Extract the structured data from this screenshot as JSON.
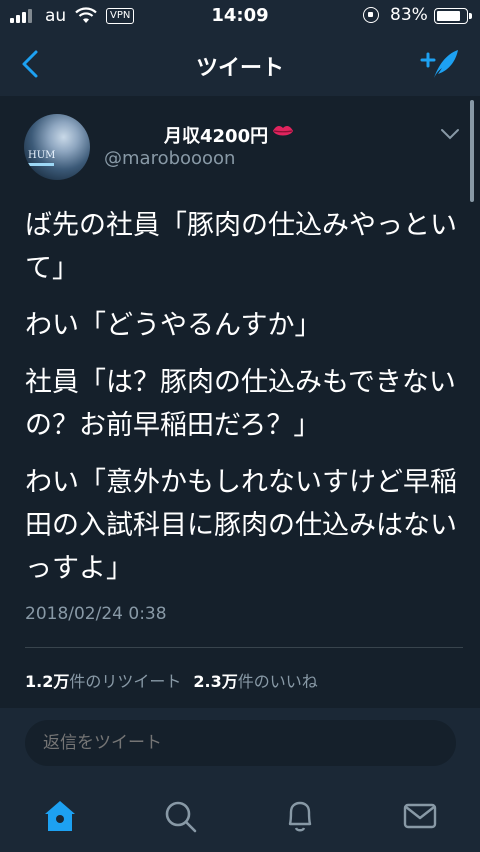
{
  "status_bar": {
    "carrier": "au",
    "vpn": "VPN",
    "time": "14:09",
    "battery_percent": "83%",
    "battery_level": 0.83
  },
  "nav": {
    "title": "ツイート",
    "back_icon": "chevron-left-icon",
    "compose_icon": "compose-feather-icon"
  },
  "tweet": {
    "display_name": "月収4200円",
    "name_emoji_icon": "lips-icon",
    "handle": "@maroboooon",
    "avatar_text": "HUM",
    "text": [
      "ば先の社員「豚肉の仕込みやっといて」",
      "わい「どうやるんすか」",
      "社員「は？豚肉の仕込みもできないの？お前早稲田だろ？」",
      "わい「意外かもしれないすけど早稲田の入試科目に豚肉の仕込みはないっすよ」"
    ],
    "timestamp": "2018/02/24 0:38",
    "retweet_count": "1.2万",
    "retweet_label": "件のリツイート",
    "like_count": "2.3万",
    "like_label": "件のいいね"
  },
  "reply": {
    "placeholder": "返信をツイート"
  },
  "tabs": [
    {
      "name": "home",
      "icon": "home-icon"
    },
    {
      "name": "search",
      "icon": "search-icon"
    },
    {
      "name": "notifications",
      "icon": "bell-icon"
    },
    {
      "name": "messages",
      "icon": "mail-icon"
    }
  ],
  "colors": {
    "accent": "#1da1f2",
    "background": "#15202b",
    "bar_background": "#1b2836",
    "secondary_text": "#8899a6"
  }
}
